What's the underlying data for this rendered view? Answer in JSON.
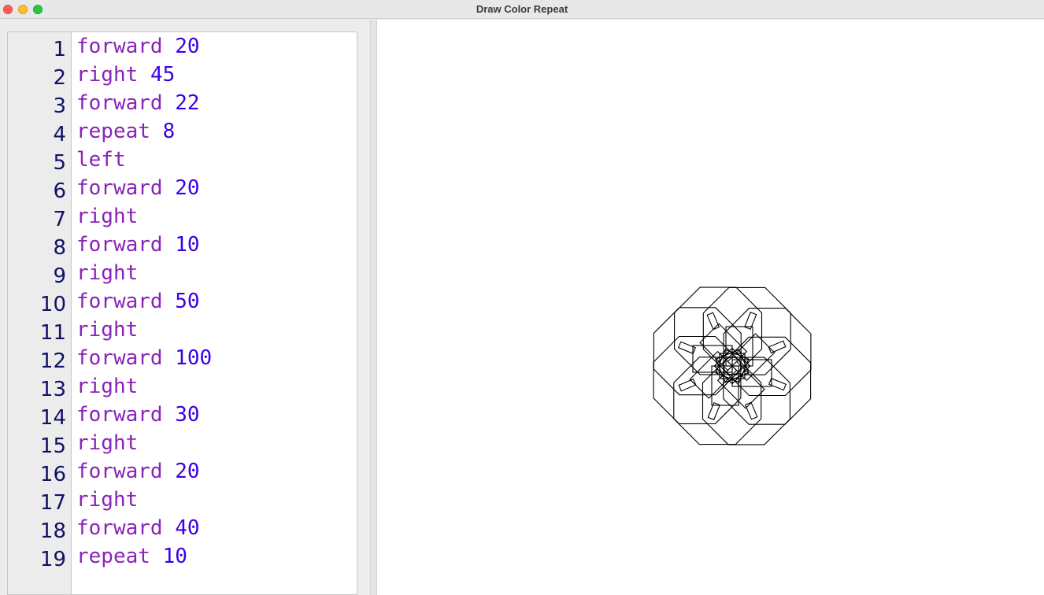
{
  "window": {
    "title": "Draw Color Repeat"
  },
  "editor": {
    "colors": {
      "command": "#8a22b8",
      "number": "#3a00e6",
      "line_number": "#111166"
    },
    "lines": [
      {
        "num": "1",
        "cmd": "forward",
        "arg": "20"
      },
      {
        "num": "2",
        "cmd": "right",
        "arg": "45"
      },
      {
        "num": "3",
        "cmd": "forward",
        "arg": "22"
      },
      {
        "num": "4",
        "cmd": "repeat",
        "arg": "8"
      },
      {
        "num": "5",
        "cmd": "left",
        "arg": ""
      },
      {
        "num": "6",
        "cmd": "forward",
        "arg": "20"
      },
      {
        "num": "7",
        "cmd": "right",
        "arg": ""
      },
      {
        "num": "8",
        "cmd": "forward",
        "arg": "10"
      },
      {
        "num": "9",
        "cmd": "right",
        "arg": ""
      },
      {
        "num": "10",
        "cmd": "forward",
        "arg": "50"
      },
      {
        "num": "11",
        "cmd": "right",
        "arg": ""
      },
      {
        "num": "12",
        "cmd": "forward",
        "arg": "100"
      },
      {
        "num": "13",
        "cmd": "right",
        "arg": ""
      },
      {
        "num": "14",
        "cmd": "forward",
        "arg": "30"
      },
      {
        "num": "15",
        "cmd": "right",
        "arg": ""
      },
      {
        "num": "16",
        "cmd": "forward",
        "arg": "20"
      },
      {
        "num": "17",
        "cmd": "right",
        "arg": ""
      },
      {
        "num": "18",
        "cmd": "forward",
        "arg": "40"
      },
      {
        "num": "19",
        "cmd": "repeat",
        "arg": "10"
      }
    ]
  },
  "drawing": {
    "stroke_color": "#000000",
    "shape": "turtle-rosette"
  }
}
